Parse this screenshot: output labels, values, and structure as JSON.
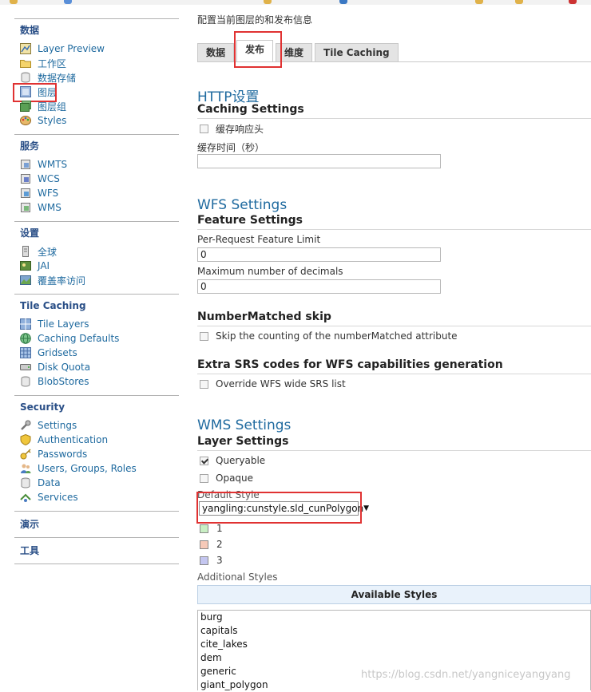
{
  "colors": {
    "accent": "#1f6a9f",
    "sidebar_title": "#2a4f87",
    "highlight": "#e03232"
  },
  "sidebar": {
    "sections": [
      {
        "title": "数据",
        "items": [
          {
            "label": "Layer Preview",
            "icon": "layer-preview-icon"
          },
          {
            "label": "工作区",
            "icon": "folder-icon"
          },
          {
            "label": "数据存储",
            "icon": "database-icon"
          },
          {
            "label": "图层",
            "icon": "layer-icon"
          },
          {
            "label": "图层组",
            "icon": "layer-group-icon"
          },
          {
            "label": "Styles",
            "icon": "palette-icon"
          }
        ]
      },
      {
        "title": "服务",
        "items": [
          {
            "label": "WMTS",
            "icon": "service-icon"
          },
          {
            "label": "WCS",
            "icon": "service-icon"
          },
          {
            "label": "WFS",
            "icon": "service-icon"
          },
          {
            "label": "WMS",
            "icon": "service-icon"
          }
        ]
      },
      {
        "title": "设置",
        "items": [
          {
            "label": "全球",
            "icon": "settings-icon"
          },
          {
            "label": "JAI",
            "icon": "jai-icon"
          },
          {
            "label": "覆盖率访问",
            "icon": "coverage-icon"
          }
        ]
      },
      {
        "title": "Tile Caching",
        "items": [
          {
            "label": "Tile Layers",
            "icon": "tile-layers-icon"
          },
          {
            "label": "Caching Defaults",
            "icon": "globe-icon"
          },
          {
            "label": "Gridsets",
            "icon": "grid-icon"
          },
          {
            "label": "Disk Quota",
            "icon": "disk-icon"
          },
          {
            "label": "BlobStores",
            "icon": "database-icon"
          }
        ]
      },
      {
        "title": "Security",
        "items": [
          {
            "label": "Settings",
            "icon": "wrench-icon"
          },
          {
            "label": "Authentication",
            "icon": "shield-icon"
          },
          {
            "label": "Passwords",
            "icon": "key-icon"
          },
          {
            "label": "Users, Groups, Roles",
            "icon": "users-icon"
          },
          {
            "label": "Data",
            "icon": "data-icon"
          },
          {
            "label": "Services",
            "icon": "services-icon"
          }
        ]
      },
      {
        "title": "演示",
        "items": []
      },
      {
        "title": "工具",
        "items": []
      }
    ]
  },
  "main": {
    "description": "配置当前图层的和发布信息",
    "tabs": [
      {
        "label": "数据"
      },
      {
        "label": "发布"
      },
      {
        "label": "维度"
      },
      {
        "label": "Tile Caching"
      }
    ],
    "http": {
      "heading": "HTTP设置",
      "subheading": "Caching Settings",
      "cache_response_headers": "缓存响应头",
      "cache_time_label": "缓存时间（秒）",
      "cache_time_value": ""
    },
    "wfs": {
      "heading": "WFS Settings",
      "subheading": "Feature Settings",
      "feature_limit_label": "Per-Request Feature Limit",
      "feature_limit_value": "0",
      "decimals_label": "Maximum number of decimals",
      "decimals_value": "0",
      "number_matched_heading": "NumberMatched skip",
      "number_matched_label": "Skip the counting of the numberMatched attribute",
      "extra_srs_heading": "Extra SRS codes for WFS capabilities generation",
      "override_srs_label": "Override WFS wide SRS list"
    },
    "wms": {
      "heading": "WMS Settings",
      "subheading": "Layer Settings",
      "queryable_label": "Queryable",
      "opaque_label": "Opaque",
      "default_style_label": "Default Style",
      "default_style_value": "yangling:cunstyle.sld_cunPolygon",
      "legend": [
        {
          "label": "1",
          "color": "#c9efc4"
        },
        {
          "label": "2",
          "color": "#f6c9b8"
        },
        {
          "label": "3",
          "color": "#c4c6f0"
        }
      ],
      "additional_styles_label": "Additional Styles",
      "available_styles_header": "Available Styles",
      "available_styles": [
        "burg",
        "capitals",
        "cite_lakes",
        "dem",
        "generic",
        "giant_polygon"
      ]
    }
  },
  "watermark": "https://blog.csdn.net/yangniceyangyang"
}
